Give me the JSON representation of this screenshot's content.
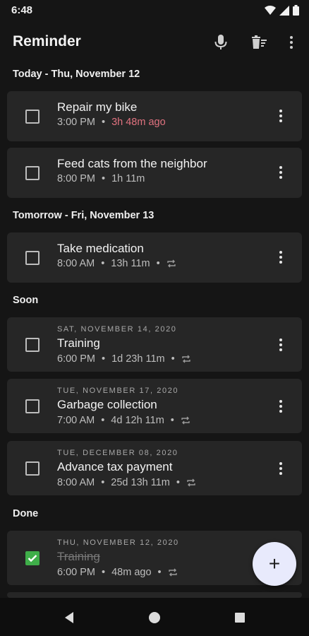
{
  "status_bar": {
    "time": "6:48"
  },
  "app_bar": {
    "title": "Reminder",
    "icons": [
      "mic-icon",
      "clear-done-icon",
      "more-vert-icon"
    ]
  },
  "sections": {
    "today": "Today - Thu, November 12",
    "tomorrow": "Tomorrow - Fri, November 13",
    "soon": "Soon",
    "done": "Done"
  },
  "tasks": [
    {
      "title": "Repair my bike",
      "time": "3:00 PM",
      "relative": "3h 48m ago",
      "overdue": true,
      "repeat": false,
      "checked": false
    },
    {
      "title": "Feed cats from the neighbor",
      "time": "8:00 PM",
      "relative": "1h 11m",
      "repeat": false,
      "checked": false
    },
    {
      "title": "Take medication",
      "time": "8:00 AM",
      "relative": "13h 11m",
      "repeat": true,
      "checked": false
    },
    {
      "date": "SAT, NOVEMBER 14, 2020",
      "title": "Training",
      "time": "6:00 PM",
      "relative": "1d 23h 11m",
      "repeat": true,
      "checked": false
    },
    {
      "date": "TUE, NOVEMBER 17, 2020",
      "title": "Garbage collection",
      "time": "7:00 AM",
      "relative": "4d 12h 11m",
      "repeat": true,
      "checked": false
    },
    {
      "date": "TUE, DECEMBER 08, 2020",
      "title": "Advance tax payment",
      "time": "8:00 AM",
      "relative": "25d 13h 11m",
      "repeat": true,
      "checked": false
    },
    {
      "date": "THU, NOVEMBER 12, 2020",
      "title": "Training",
      "time": "6:00 PM",
      "relative": "48m ago",
      "repeat": true,
      "checked": true
    }
  ],
  "fab": {
    "label": "+"
  },
  "colors": {
    "background": "#151515",
    "card": "#262626",
    "overdue": "#e0727f",
    "check": "#3fae49",
    "fab": "#e8eafc"
  }
}
